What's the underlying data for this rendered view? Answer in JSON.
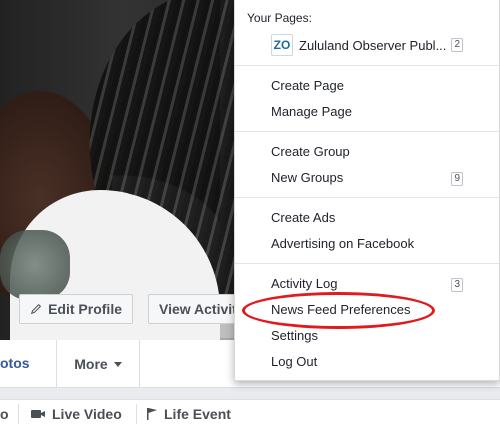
{
  "cover": {
    "edit_profile_label": "Edit Profile",
    "view_activity_label": "View Activit"
  },
  "profile_nav": {
    "photos_label": "otos",
    "more_label": "More"
  },
  "composer": {
    "first_label": "o",
    "live_video_label": "Live Video",
    "life_event_label": "Life Event"
  },
  "dropdown": {
    "header": "Your Pages:",
    "page": {
      "avatar_text": "ZO",
      "name": "Zululand Observer Publ...",
      "badge": "2"
    },
    "group1": {
      "create_page": "Create Page",
      "manage_page": "Manage Page"
    },
    "group2": {
      "create_group": "Create Group",
      "new_groups": "New Groups",
      "new_groups_badge": "9"
    },
    "group3": {
      "create_ads": "Create Ads",
      "advertising": "Advertising on Facebook"
    },
    "group4": {
      "activity_log": "Activity Log",
      "activity_log_badge": "3",
      "news_feed_preferences": "News Feed Preferences",
      "settings": "Settings",
      "log_out": "Log Out"
    }
  },
  "colors": {
    "highlight_ring": "#e01b1f",
    "link": "#365899"
  }
}
